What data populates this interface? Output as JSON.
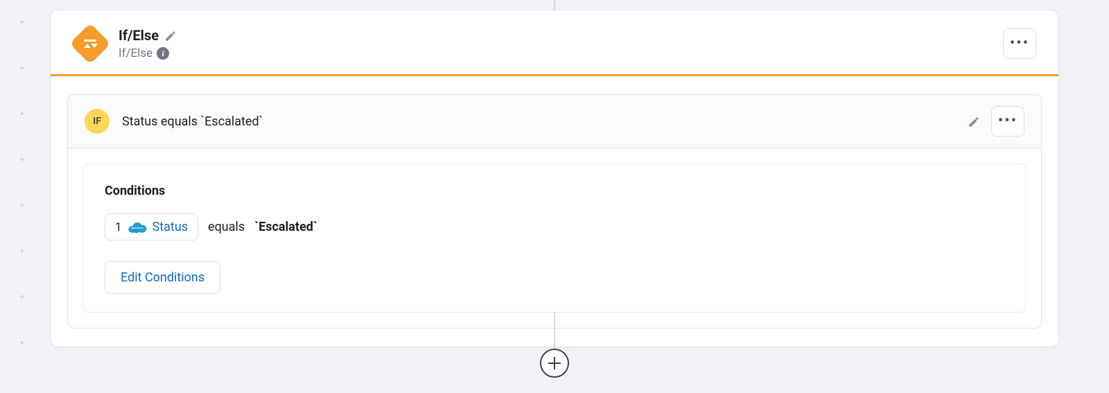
{
  "step": {
    "title": "If/Else",
    "type_label": "If/Else"
  },
  "branch": {
    "badge": "IF",
    "summary": "Status equals `Escalated`"
  },
  "conditions": {
    "heading": "Conditions",
    "edit_label": "Edit Conditions",
    "items": [
      {
        "index": "1",
        "field": "Status",
        "operator": "equals",
        "value": "`Escalated`"
      }
    ]
  },
  "colors": {
    "accent": "#f79b2b",
    "link": "#1068c9",
    "if_badge": "#ffd659"
  }
}
